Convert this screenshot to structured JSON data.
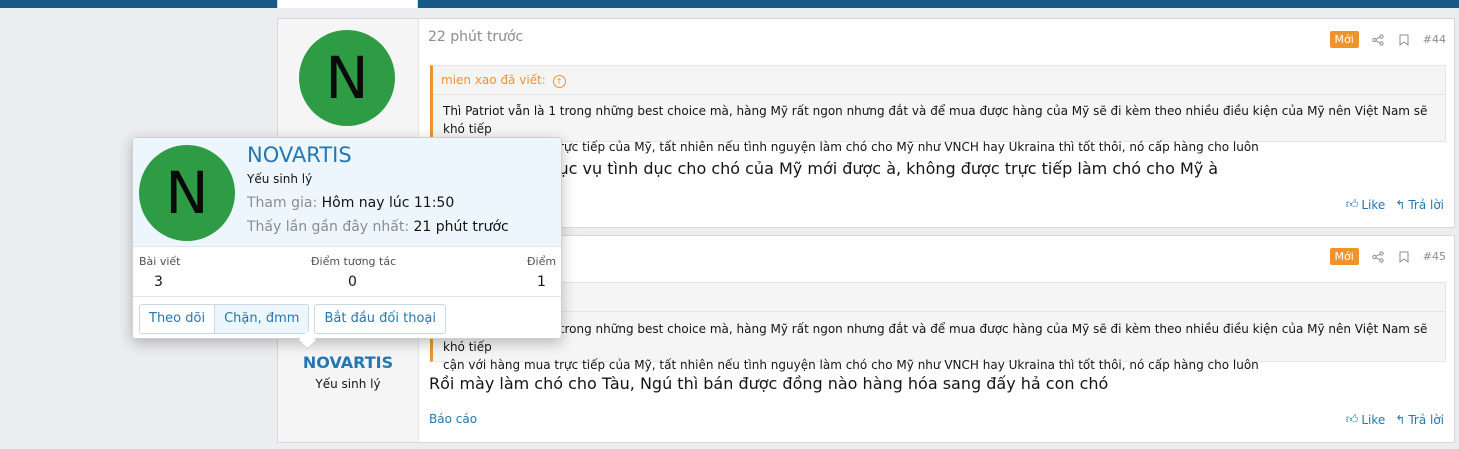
{
  "post44": {
    "time": "22 phút trước",
    "badge": "Mới",
    "number": "#44",
    "avatar_letter": "N",
    "quote_author": "mien xao đã viết:",
    "quote_line1": "Thì Patriot vẫn là 1 trong những best choice mà, hàng Mỹ rất ngon nhưng đắt và để mua được hàng của Mỹ sẽ đi kèm theo nhiều điều kiện của Mỹ nên Việt Nam sẽ khó tiếp",
    "quote_line2": "cận với hàng mua trực tiếp của Mỹ, tất nhiên nếu tình nguyện làm chó cho Mỹ như VNCH hay Ukraina thì tốt thôi, nó cấp hàng cho luôn",
    "message": "Phải làm phò phục vụ tình dục cho chó của Mỹ mới được à, không được trực tiếp làm chó cho Mỹ à",
    "like": "Like",
    "reply": "Trả lời"
  },
  "post45": {
    "badge": "Mới",
    "number": "#45",
    "quote_line1": "Thì Patriot vẫn là 1 trong những best choice mà, hàng Mỹ rất ngon nhưng đắt và để mua được hàng của Mỹ sẽ đi kèm theo nhiều điều kiện của Mỹ nên Việt Nam sẽ khó tiếp",
    "quote_line2": "cận với hàng mua trực tiếp của Mỹ, tất nhiên nếu tình nguyện làm chó cho Mỹ như VNCH hay Ukraina thì tốt thôi, nó cấp hàng cho luôn",
    "message": "Rồi mày làm chó cho Tàu, Ngú thì bán được đồng nào hàng hóa sang đấy hả con chó",
    "username": "NOVARTIS",
    "user_title": "Yếu sinh lý",
    "report": "Báo cáo",
    "like": "Like",
    "reply": "Trả lời"
  },
  "card": {
    "avatar_letter": "N",
    "name": "NOVARTIS",
    "title": "Yếu sinh lý",
    "joined_label": "Tham gia:",
    "joined_value": "Hôm nay lúc 11:50",
    "seen_label": "Thấy lần gần đây nhất:",
    "seen_value": "21 phút trước",
    "stats": [
      {
        "label": "Bài viết",
        "value": "3"
      },
      {
        "label": "Điểm tương tác",
        "value": "0"
      },
      {
        "label": "Điểm",
        "value": "1"
      }
    ],
    "buttons": {
      "follow": "Theo dõi",
      "block": "Chặn, đmm",
      "start_conversation": "Bắt đầu đối thoại"
    }
  },
  "colors": {
    "accent": "#2577b1",
    "badge": "#f0932b",
    "avatar": "#2e9c45",
    "topbar": "#185886"
  }
}
